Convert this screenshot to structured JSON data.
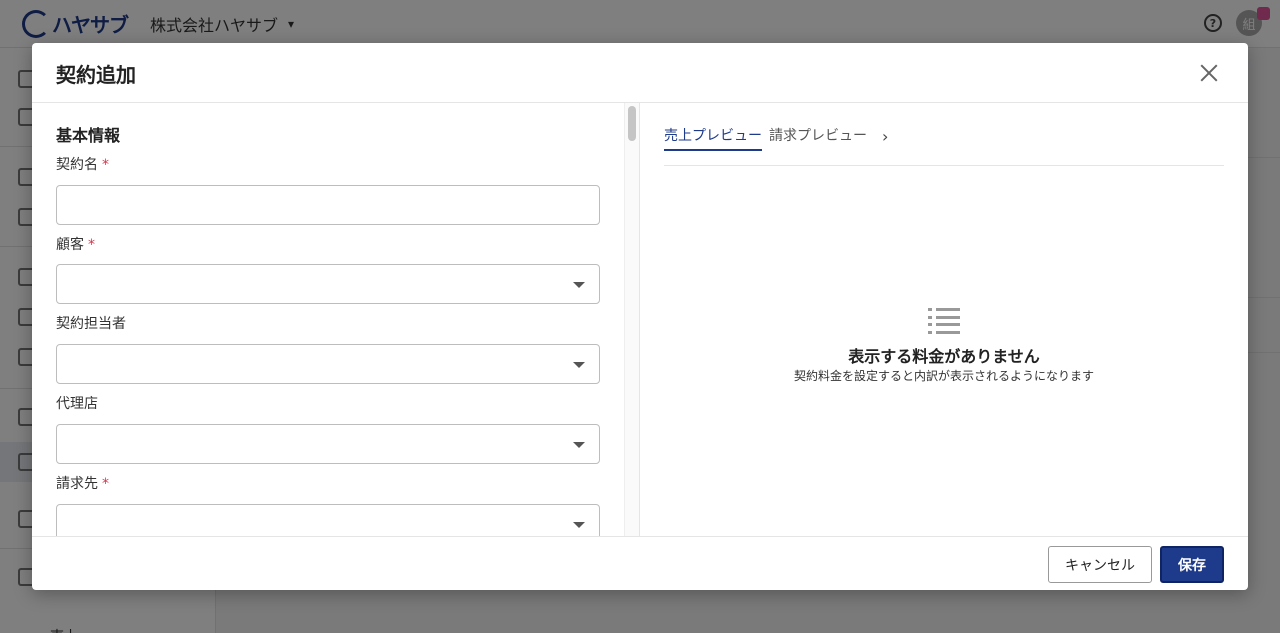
{
  "app": {
    "logo_text": "ハヤサブ",
    "company": "株式会社ハヤサブ",
    "avatar_initial": "組",
    "sidebar_partial_text": "売上"
  },
  "modal": {
    "title": "契約追加",
    "section_title": "基本情報",
    "required_mark": "*",
    "fields": {
      "contract_name": "契約名",
      "customer": "顧客",
      "contract_owner": "契約担当者",
      "agency": "代理店",
      "billing_to": "請求先"
    },
    "tabs": {
      "sales_preview": "売上プレビュー",
      "billing_preview": "請求プレビュー"
    },
    "empty_state": {
      "title": "表示する料金がありません",
      "subtitle": "契約料金を設定すると内訳が表示されるようになります"
    },
    "buttons": {
      "cancel": "キャンセル",
      "save": "保存"
    }
  },
  "colors": {
    "accent": "#1e3a8a",
    "required": "#d9334e"
  }
}
